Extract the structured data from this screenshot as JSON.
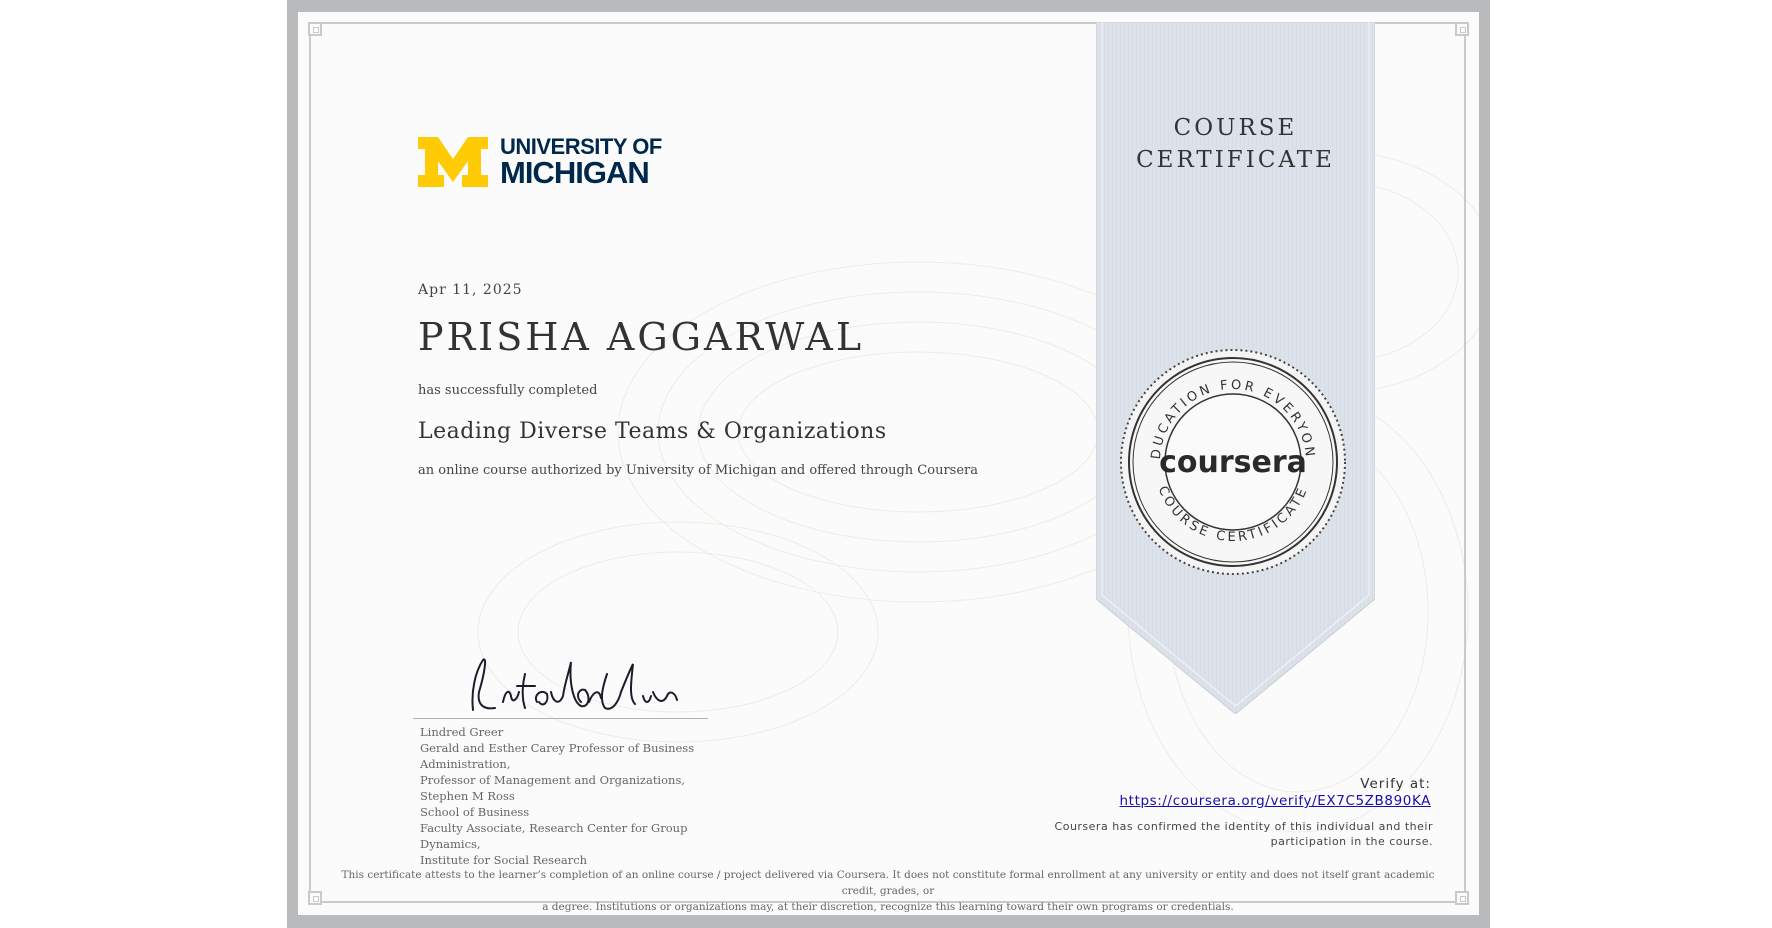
{
  "certificate": {
    "institution_logo_text": {
      "line1": "UNIVERSITY OF",
      "line2": "MICHIGAN"
    },
    "date": "Apr 11, 2025",
    "recipient": "PRISHA AGGARWAL",
    "completed_text": "has successfully completed",
    "course_name": "Leading Diverse Teams & Organizations",
    "authorized_text": "an online course authorized by University of Michigan and offered through Coursera",
    "ribbon_title_line1": "COURSE",
    "ribbon_title_line2": "CERTIFICATE",
    "seal": {
      "center_text": "coursera",
      "top_arc_text": "EDUCATION FOR EVERYONE",
      "bottom_arc_text": "COURSE CERTIFICATE"
    },
    "signer": {
      "name": "Lindred Greer",
      "title_line1": "Gerald and Esther Carey Professor of Business Administration,",
      "title_line2": "Professor of Management and Organizations, Stephen M Ross",
      "title_line3": "School of Business",
      "title_line4": "Faculty Associate, Research Center for Group Dynamics,",
      "title_line5": "Institute for Social Research"
    },
    "verify_label": "Verify at:",
    "verify_url": "https://coursera.org/verify/EX7C5ZB890KA",
    "confirmed_line1": "Coursera has confirmed the identity of this individual and their",
    "confirmed_line2": "participation in the course.",
    "disclaimer_line1": "This certificate attests to the learner’s completion of an online course / project delivered via Coursera. It does not constitute formal enrollment at any university or entity and does not itself grant academic credit, grades, or",
    "disclaimer_line2": "a degree. Institutions or organizations may, at their discretion, recognize this learning toward their own programs or credentials."
  },
  "colors": {
    "frame": "#b9babc",
    "ribbon": "#dde2ea",
    "michigan_maize": "#ffcb05",
    "michigan_blue": "#00274c",
    "link": "#1a0dab"
  }
}
